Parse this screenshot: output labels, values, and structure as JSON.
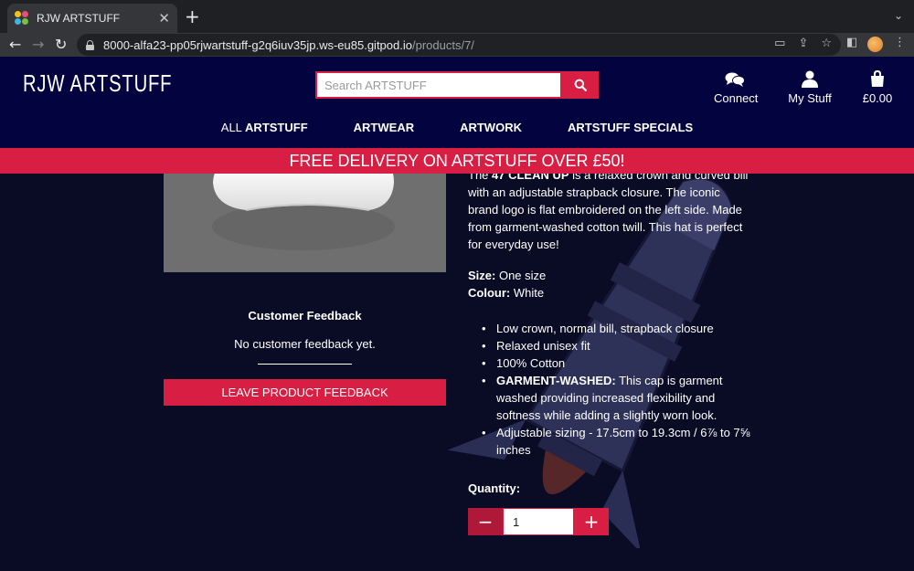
{
  "browser": {
    "tab_title": "RJW ARTSTUFF",
    "url_host": "8000-alfa23-pp05rjwartstuff-g2q6iuv35jp.ws-eu85.gitpod.io",
    "url_path": "/products/7/"
  },
  "header": {
    "logo": "RJW ARTSTUFF",
    "search_placeholder": "Search ARTSTUFF",
    "connect_label": "Connect",
    "my_stuff_label": "My Stuff",
    "basket_total": "£0.00"
  },
  "nav": {
    "all_prefix": "ALL ",
    "all_bold": "ARTSTUFF",
    "artwear": "ARTWEAR",
    "artwork": "ARTWORK",
    "specials": "ARTSTUFF SPECIALS"
  },
  "promo": "FREE DELIVERY ON ARTSTUFF OVER £50!",
  "feedback": {
    "title": "Customer Feedback",
    "empty_text": "No customer feedback yet.",
    "button_label": "LEAVE PRODUCT FEEDBACK"
  },
  "product": {
    "desc_prefix": "The ",
    "desc_bold": "47 CLEAN UP",
    "desc_rest": " is a relaxed crown and curved bill with an adjustable strapback closure. The iconic brand logo is flat embroidered on the left side. Made from garment-washed cotton twill. This hat is perfect for everyday use!",
    "size_label": "Size:",
    "size_value": " One size",
    "colour_label": "Colour:",
    "colour_value": " White",
    "features": [
      {
        "bold": "",
        "text": "Low crown, normal bill, strapback closure"
      },
      {
        "bold": "",
        "text": "Relaxed unisex fit"
      },
      {
        "bold": "",
        "text": "100% Cotton"
      },
      {
        "bold": "GARMENT-WASHED:",
        "text": " This cap is garment washed providing increased flexibility and softness while adding a slightly worn look."
      },
      {
        "bold": "",
        "text": "Adjustable sizing - 17.5cm to 19.3cm / 6⅞ to 7⅝ inches"
      }
    ],
    "quantity_label": "Quantity:",
    "quantity_value": "1"
  },
  "colors": {
    "brand_navy": "#02033f",
    "accent_red": "#d91e44",
    "page_bg": "#0a0b24"
  }
}
